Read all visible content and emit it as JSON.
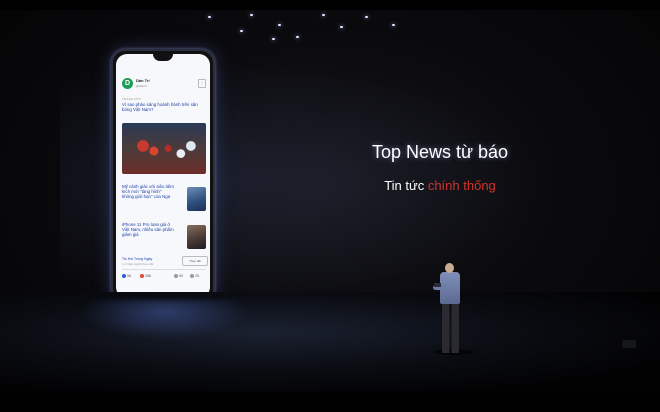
{
  "slide": {
    "title": "Top News từ báo",
    "subtitle_part1": "Tin tức ",
    "subtitle_part2": "chính thống"
  },
  "phone_app": {
    "logo_letter": "D",
    "app_name": "Dân Trí",
    "app_sub": "@dantri",
    "section_label": "TRANG MỚI",
    "articles": [
      {
        "headline": "Vì sao pháo sáng hoành hành trên sân bóng Việt Nam?"
      },
      {
        "headline": "Mỹ cảnh giác với siêu tiêm kích mới \"tàng hình\" không giới hạn\" của Nga"
      },
      {
        "headline": "iPhone 11 Pro loan giá ở Việt Nam, nhiều sản phẩm giảm giá"
      }
    ],
    "footer": {
      "title": "Tin Hot Trong Ngày",
      "subtitle": "1,2 triệu người theo dõi",
      "follow_label": "Theo dõi",
      "stats": [
        "96",
        "286",
        "90",
        "25"
      ]
    }
  },
  "colors": {
    "accent_red": "#d2322d",
    "headline_blue": "#1d3fa8",
    "logo_green": "#1e9c58"
  }
}
